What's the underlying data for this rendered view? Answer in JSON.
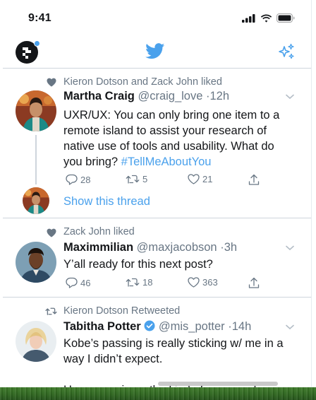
{
  "status": {
    "time": "9:41"
  },
  "colors": {
    "accent": "#4aa1ec",
    "text": "#141619",
    "muted": "#687684",
    "divider": "#ced5dc"
  },
  "tweets": [
    {
      "context": "Kieron Dotson and Zack John liked",
      "context_icon": "heart-icon",
      "name": "Martha Craig",
      "handle": "@craig_love",
      "time": "·12h",
      "text_lines": [
        "UXR/UX: You can only bring one item to a",
        "remote island to assist your research of",
        "native use of tools and usability. What do",
        "you bring? "
      ],
      "hashtag": "#TellMeAboutYou",
      "replies": "28",
      "retweets": "5",
      "likes": "21",
      "show_thread": "Show this thread"
    },
    {
      "context": "Zack John liked",
      "context_icon": "heart-icon",
      "name": "Maximmilian",
      "handle": "@maxjacobson",
      "time": "·3h",
      "text_lines": [
        "Y’all ready for this next post?"
      ],
      "replies": "46",
      "retweets": "18",
      "likes": "363"
    },
    {
      "context": "Kieron Dotson Retweeted",
      "context_icon": "retweet-icon",
      "name": "Tabitha Potter",
      "handle": "@mis_potter",
      "time": "·14h",
      "text_lines": [
        "Kobe’s passing is really sticking w/ me in a",
        "way I didn’t expect.",
        "He was an icon, the kind of person who"
      ]
    }
  ]
}
